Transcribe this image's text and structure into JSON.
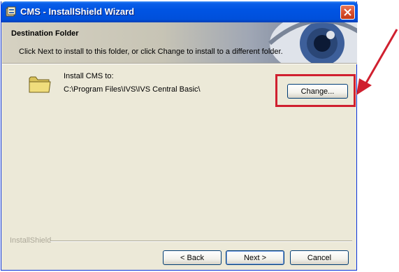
{
  "window": {
    "title": "CMS - InstallShield Wizard",
    "accent_color": "#0054e3",
    "close_icon": "close-icon"
  },
  "header": {
    "title": "Destination Folder",
    "description": "Click Next to install to this folder, or click Change to install to a different folder."
  },
  "content": {
    "install_label": "Install CMS to:",
    "install_path": "C:\\Program Files\\IVS\\IVS Central Basic\\",
    "change_label": "Change..."
  },
  "footer": {
    "brand": "InstallShield",
    "back_label": "< Back",
    "next_label": "Next >",
    "cancel_label": "Cancel"
  },
  "annotation": {
    "highlight_color": "#d0202f"
  }
}
